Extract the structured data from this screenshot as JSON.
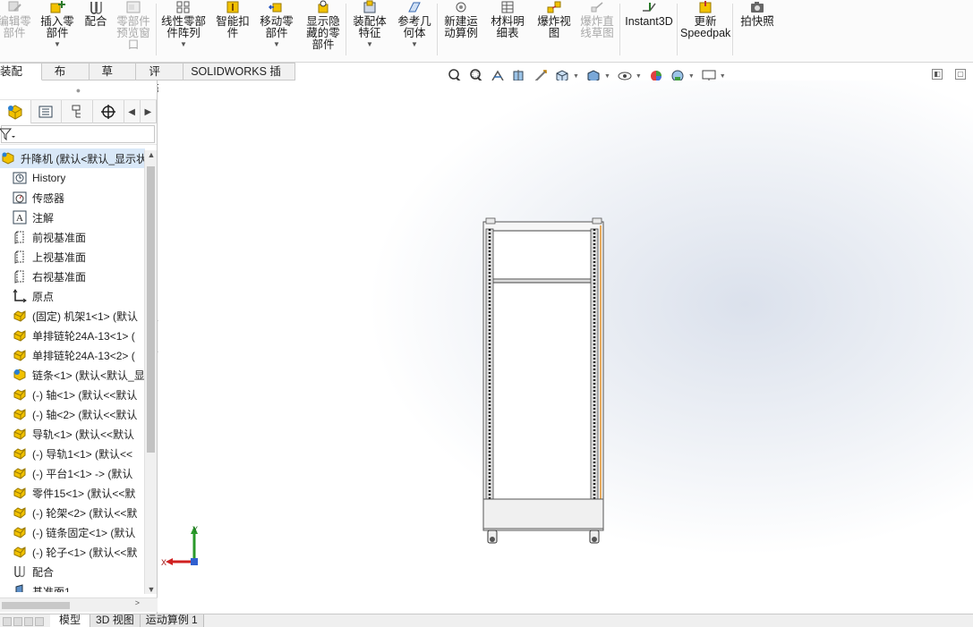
{
  "ribbon": {
    "buttons": [
      {
        "id": "edit-component",
        "label": "编辑零\n部件",
        "icon": "edit-component-icon",
        "disabled": true
      },
      {
        "id": "insert-components",
        "label": "插入零\n部件",
        "icon": "insert-component-icon",
        "disabled": false
      },
      {
        "id": "mate",
        "label": "配合",
        "icon": "mate-icon",
        "disabled": false
      },
      {
        "id": "component-preview",
        "label": "零部件\n预览窗\n口",
        "icon": "preview-window-icon",
        "disabled": true
      },
      {
        "id": "linear-pattern",
        "label": "线性零部\n件阵列",
        "icon": "linear-pattern-icon",
        "disabled": false
      },
      {
        "id": "smart-fasteners",
        "label": "智能扣\n件",
        "icon": "smart-fastener-icon",
        "disabled": false
      },
      {
        "id": "move-component",
        "label": "移动零\n部件",
        "icon": "move-component-icon",
        "disabled": false
      },
      {
        "id": "show-hidden",
        "label": "显示隐\n藏的零\n部件",
        "icon": "show-hidden-icon",
        "disabled": false
      },
      {
        "id": "assembly-features",
        "label": "装配体\n特征",
        "icon": "assembly-feature-icon",
        "disabled": false
      },
      {
        "id": "reference-geometry",
        "label": "参考几\n何体",
        "icon": "reference-geometry-icon",
        "disabled": false
      },
      {
        "id": "new-motion-study",
        "label": "新建运\n动算例",
        "icon": "motion-study-icon",
        "disabled": false
      },
      {
        "id": "bill-of-materials",
        "label": "材料明\n细表",
        "icon": "bom-icon",
        "disabled": false
      },
      {
        "id": "exploded-view",
        "label": "爆炸视\n图",
        "icon": "exploded-view-icon",
        "disabled": false
      },
      {
        "id": "explode-line-sketch",
        "label": "爆炸直\n线草图",
        "icon": "explode-line-icon",
        "disabled": true
      },
      {
        "id": "instant3d",
        "label": "Instant3D",
        "icon": "instant3d-icon",
        "disabled": false
      },
      {
        "id": "update-speedpak",
        "label": "更新\nSpeedpak",
        "icon": "speedpak-icon",
        "disabled": false
      },
      {
        "id": "take-snapshot",
        "label": "拍快照",
        "icon": "camera-icon",
        "disabled": false
      }
    ]
  },
  "command_tabs": [
    "装配体",
    "布局",
    "草图",
    "评估",
    "SOLIDWORKS 插件"
  ],
  "tree": {
    "root": "升降机  (默认<默认_显示状",
    "items": [
      {
        "label": "History",
        "icon": "history-icon"
      },
      {
        "label": "传感器",
        "icon": "sensor-icon"
      },
      {
        "label": "注解",
        "icon": "annotation-icon"
      },
      {
        "label": "前视基准面",
        "icon": "plane-icon"
      },
      {
        "label": "上视基准面",
        "icon": "plane-icon"
      },
      {
        "label": "右视基准面",
        "icon": "plane-icon"
      },
      {
        "label": "原点",
        "icon": "origin-icon"
      },
      {
        "label": "(固定) 机架1<1> (默认",
        "icon": "part-icon"
      },
      {
        "label": "单排链轮24A-13<1> (",
        "icon": "part-icon"
      },
      {
        "label": "单排链轮24A-13<2> (",
        "icon": "part-icon"
      },
      {
        "label": "链条<1> (默认<默认_显",
        "icon": "subassembly-icon"
      },
      {
        "label": "(-) 轴<1> (默认<<默认",
        "icon": "part-icon"
      },
      {
        "label": "(-) 轴<2> (默认<<默认",
        "icon": "part-icon"
      },
      {
        "label": "导轨<1> (默认<<默认",
        "icon": "part-icon"
      },
      {
        "label": "(-) 导轨1<1> (默认<<",
        "icon": "part-icon"
      },
      {
        "label": "(-) 平台1<1> -> (默认",
        "icon": "part-icon"
      },
      {
        "label": "零件15<1> (默认<<默",
        "icon": "part-icon"
      },
      {
        "label": "(-) 轮架<2> (默认<<默",
        "icon": "part-icon"
      },
      {
        "label": "(-) 链条固定<1> (默认",
        "icon": "part-icon"
      },
      {
        "label": "(-) 轮子<1> (默认<<默",
        "icon": "part-icon"
      },
      {
        "label": "配合",
        "icon": "mates-folder-icon"
      },
      {
        "label": "基准面1",
        "icon": "plane-solid-icon"
      }
    ]
  },
  "triad": {
    "x_label": "X",
    "y_label": "Y"
  },
  "bottom_tabs": [
    "模型",
    "3D 视图",
    "运动算例 1"
  ],
  "colors": {
    "accent": "#0070c0",
    "part_yellow": "#e8b400",
    "tree_selected": "#d9e8f8"
  }
}
